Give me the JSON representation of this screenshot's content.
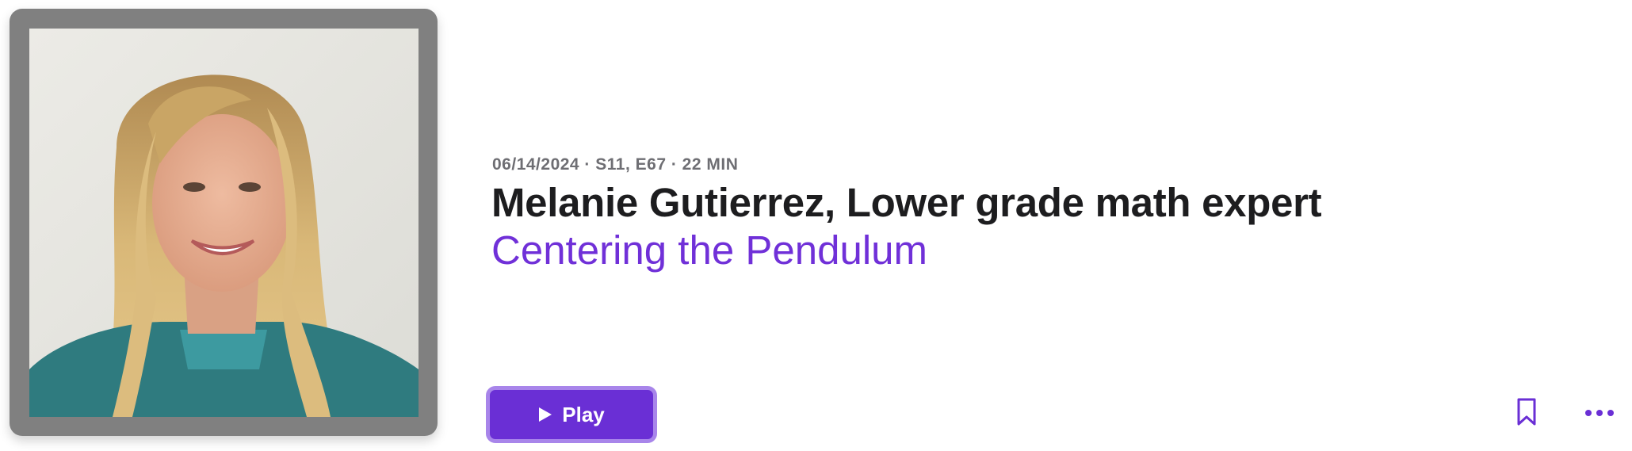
{
  "episode": {
    "meta": "06/14/2024 · S11, E67 · 22 MIN",
    "title": "Melanie Gutierrez, Lower grade math expert",
    "show": "Centering the Pendulum"
  },
  "actions": {
    "play_label": "Play",
    "play_icon": "play-icon",
    "bookmark_icon": "bookmark-icon",
    "more_icon": "more-icon"
  },
  "colors": {
    "accent": "#6a2fd5",
    "show_link": "#7030d8",
    "artwork_frame": "#808080"
  }
}
